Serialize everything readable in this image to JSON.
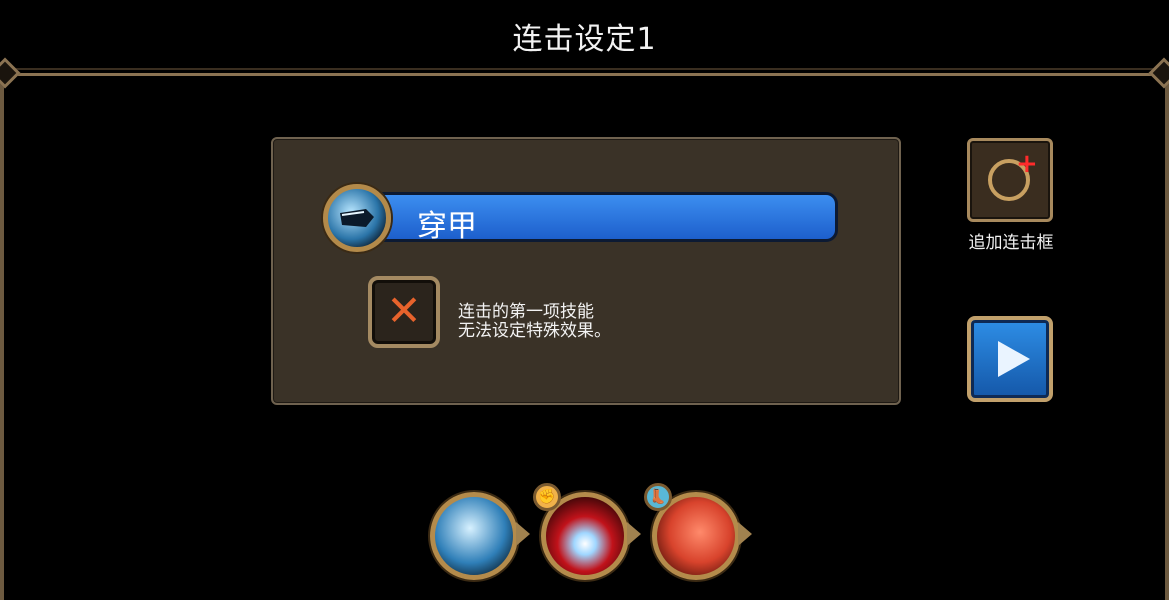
{
  "title": "连击设定1",
  "skill": {
    "name": "穿甲",
    "icon": "armor-pierce-fist-icon"
  },
  "notice": {
    "line1": "连击的第一项技能",
    "line2": "无法设定特殊效果。",
    "icon": "close-icon"
  },
  "add_combo": {
    "label": "追加连击框",
    "icon": "add-ring-icon"
  },
  "next": {
    "icon": "play-icon"
  },
  "combo_chain": [
    {
      "icon": "ice-fist-icon",
      "badge": null
    },
    {
      "icon": "red-burst-icon",
      "badge": "fist-badge-icon"
    },
    {
      "icon": "red-kick-icon",
      "badge": "boot-badge-icon"
    }
  ],
  "colors": {
    "accent_blue": "#2a7fe0",
    "frame_gold": "#b38a4a",
    "panel_bg": "#3a3227",
    "x_orange": "#e8632c"
  }
}
